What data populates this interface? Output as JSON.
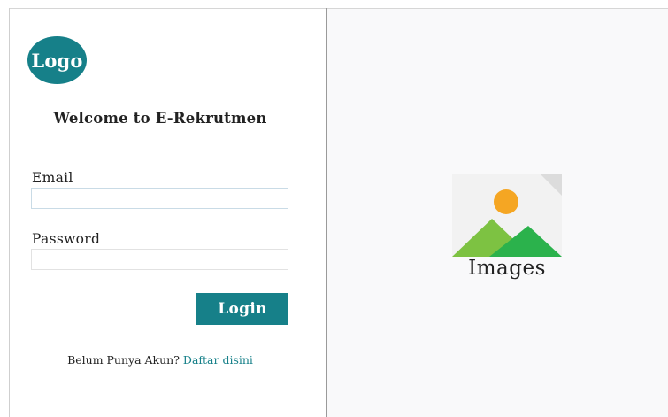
{
  "login": {
    "logo_text": "Logo",
    "welcome_text": "Welcome to E-Rekrutmen",
    "email_label": "Email",
    "email_value": "",
    "password_label": "Password",
    "password_value": "",
    "login_button_label": "Login",
    "register_prompt": "Belum Punya Akun?",
    "register_link_label": "Daftar disini"
  },
  "image_panel": {
    "icon": "image-placeholder-icon",
    "caption": "Images"
  },
  "colors": {
    "accent": "#168089",
    "image_panel_background": "#f9f9fa",
    "sun": "#f5a623",
    "mountain_light": "#7dc242",
    "mountain_dark": "#2bb24c"
  }
}
